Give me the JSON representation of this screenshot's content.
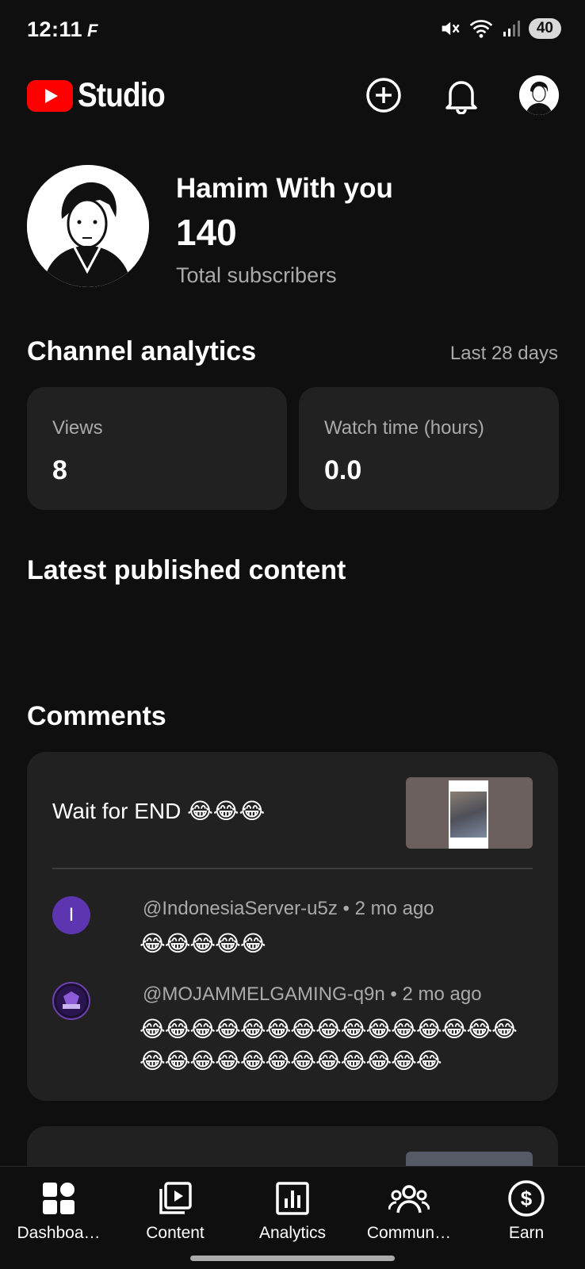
{
  "status_bar": {
    "time": "12:11",
    "battery": "40"
  },
  "app_bar": {
    "brand": "Studio"
  },
  "channel": {
    "name": "Hamim With you",
    "subscriber_count": "140",
    "subscriber_label": "Total subscribers"
  },
  "analytics": {
    "title": "Channel analytics",
    "period": "Last 28 days",
    "cards": [
      {
        "label": "Views",
        "value": "8"
      },
      {
        "label": "Watch time (hours)",
        "value": "0.0"
      }
    ]
  },
  "latest": {
    "title": "Latest published content"
  },
  "comments": {
    "title": "Comments",
    "video_title": "Wait for END 😂😂😂",
    "items": [
      {
        "avatar_letter": "I",
        "author": "@IndonesiaServer-u5z",
        "time": "2 mo ago",
        "text": "😂😂😂😂😂"
      },
      {
        "avatar_letter": "",
        "author": "@MOJAMMELGAMING-q9n",
        "time": "2 mo ago",
        "text": "😂😂😂😂😂😂😂😂😂😂😂😂😂😂😂😂😂😂😂😂😂😂😂😂😂😂😂"
      }
    ]
  },
  "bottom_nav": [
    {
      "label": "Dashboa…",
      "icon": "dashboard-icon"
    },
    {
      "label": "Content",
      "icon": "content-icon"
    },
    {
      "label": "Analytics",
      "icon": "analytics-icon"
    },
    {
      "label": "Commun…",
      "icon": "community-icon"
    },
    {
      "label": "Earn",
      "icon": "earn-icon"
    }
  ]
}
